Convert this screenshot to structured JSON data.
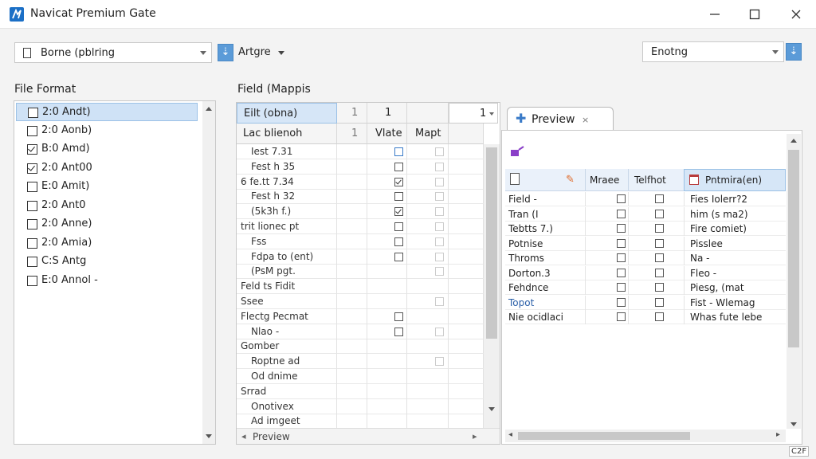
{
  "window": {
    "title": "Navicat Premium Gate",
    "badge": "C2F"
  },
  "toolbar": {
    "source_value": "Borne (pblring",
    "target_button_label": "Artgre",
    "encoding_value": "Enotng"
  },
  "file_format": {
    "label": "File Format",
    "items": [
      {
        "label": "2:0 Andt)",
        "checked": false,
        "selected": true
      },
      {
        "label": "2:0 Aonb)",
        "checked": false,
        "selected": false
      },
      {
        "label": "B:0 Amd)",
        "checked": true,
        "selected": false
      },
      {
        "label": "2:0 Ant00",
        "checked": true,
        "selected": false
      },
      {
        "label": "E:0 Amit)",
        "checked": false,
        "selected": false
      },
      {
        "label": "2:0 Ant0",
        "checked": false,
        "selected": false
      },
      {
        "label": "2:0 Anne)",
        "checked": false,
        "selected": false
      },
      {
        "label": "2:0 Amia)",
        "checked": false,
        "selected": false
      },
      {
        "label": "C:S Antg",
        "checked": false,
        "selected": false
      },
      {
        "label": "E:0 Annol -",
        "checked": false,
        "selected": false
      }
    ]
  },
  "field_mapping": {
    "label": "Field (Mappis",
    "header1": {
      "c1": "Eilt (obna)",
      "c2": "1",
      "c3": "1",
      "c5": "1"
    },
    "header2": {
      "c1": "Lac blienoh",
      "c2": "1",
      "c3": "Vlate",
      "c4": "Mapt"
    },
    "rows": [
      {
        "name": "Iest 7.31",
        "indent": true,
        "cb1": "blue",
        "cb2": "light"
      },
      {
        "name": "Fest h 35",
        "indent": true,
        "cb1": "normal",
        "cb2": "light"
      },
      {
        "name": "6 fe.tt 7.34",
        "indent": false,
        "cb1": "mark",
        "cb2": "light"
      },
      {
        "name": "Fest h 32",
        "indent": true,
        "cb1": "normal",
        "cb2": "light"
      },
      {
        "name": "(5k3h f.)",
        "indent": true,
        "cb1": "mark",
        "cb2": "light"
      },
      {
        "name": "trit lionec pt",
        "indent": false,
        "cb1": "normal",
        "cb2": "light"
      },
      {
        "name": "Fss",
        "indent": true,
        "cb1": "normal",
        "cb2": "light"
      },
      {
        "name": "Fdpa to (ent)",
        "indent": true,
        "cb1": "normal",
        "cb2": "light"
      },
      {
        "name": "(PsM pgt.",
        "indent": true,
        "cb1": "none",
        "cb2": "light"
      },
      {
        "name": "Feld ts Fidit",
        "indent": false,
        "cb1": "none",
        "cb2": "none"
      },
      {
        "name": "Ssee",
        "indent": false,
        "cb1": "none",
        "cb2": "light"
      },
      {
        "name": "Flectg Pecmat",
        "indent": false,
        "cb1": "normal",
        "cb2": "none"
      },
      {
        "name": "Nlao -",
        "indent": true,
        "cb1": "normal",
        "cb2": "light"
      },
      {
        "name": "Gomber",
        "indent": false,
        "cb1": "none",
        "cb2": "none"
      },
      {
        "name": "Roptne ad",
        "indent": true,
        "cb1": "none",
        "cb2": "light"
      },
      {
        "name": "Od dnime",
        "indent": true,
        "cb1": "none",
        "cb2": "none"
      },
      {
        "name": "Srrad",
        "indent": false,
        "cb1": "none",
        "cb2": "none"
      },
      {
        "name": "Onotivex",
        "indent": true,
        "cb1": "none",
        "cb2": "none"
      },
      {
        "name": "Ad imgeet",
        "indent": true,
        "cb1": "none",
        "cb2": "none"
      }
    ],
    "footer": "Preview"
  },
  "preview": {
    "tab_label": "Preview",
    "headers": {
      "c2": "Mraee",
      "c3": "Telfhot",
      "c4": "Pntmira(en)"
    },
    "rows": [
      {
        "name": "Field -",
        "color": "dark",
        "value": "Fies Iolerr?2"
      },
      {
        "name": "Tran (I",
        "color": "dark",
        "value": "him (s ma2)"
      },
      {
        "name": "Tebtts 7.)",
        "color": "dark",
        "value": "Fire comiet)"
      },
      {
        "name": "Potnise",
        "color": "dark",
        "value": "Pisslee"
      },
      {
        "name": "Throms",
        "color": "dark",
        "value": "Na -"
      },
      {
        "name": "Dorton.3",
        "color": "dark",
        "value": "Fleo -"
      },
      {
        "name": "Fehdnce",
        "color": "dark",
        "value": "Piesg, (mat"
      },
      {
        "name": "Topot",
        "color": "blue",
        "value": "Fist - Wlemag"
      },
      {
        "name": "Nie ocidlaci",
        "color": "dark",
        "value": "Whas fute lebe"
      }
    ]
  },
  "colors": {
    "accent": "#3a7bc8",
    "selection": "#cfe2f6",
    "header_selected": "#d6e6f7"
  }
}
